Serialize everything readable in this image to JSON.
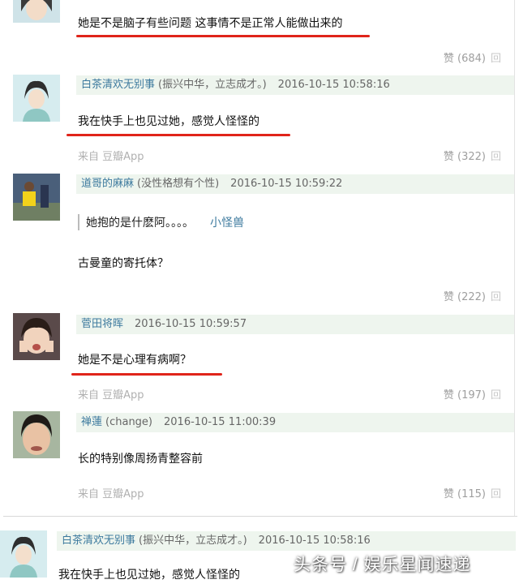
{
  "comments": [
    {
      "text": "她是不是脑子有些问题 这事情不是正常人能做出来的",
      "likes_label": "赞 (684)",
      "more_label": "回"
    },
    {
      "author": "白茶清欢无别事",
      "signature": "(振兴中华，立志成才。)",
      "time": "2016-10-15 10:58:16",
      "text": "我在快手上也见过她，感觉人怪怪的",
      "source": "来自 豆瓣App",
      "likes_label": "赞 (322)",
      "more_label": "回"
    },
    {
      "author": "道哥的麻麻",
      "signature": "(没性格想有个性)",
      "time": "2016-10-15 10:59:22",
      "quote_text": "她抱的是什麽阿。。。。",
      "quote_author": "小怪兽",
      "text": "古曼童的寄托体？",
      "likes_label": "赞 (222)",
      "more_label": "回"
    },
    {
      "author": "菅田将晖",
      "time": "2016-10-15 10:59:57",
      "text": "她是不是心理有病啊？",
      "source": "来自 豆瓣App",
      "likes_label": "赞 (197)",
      "more_label": "回"
    },
    {
      "author": "禅蓮",
      "signature": "(change)",
      "time": "2016-10-15 11:00:39",
      "text": "长的特别像周扬青整容前",
      "source": "来自 豆瓣App",
      "likes_label": "赞 (115)",
      "more_label": "回"
    },
    {
      "author": "白茶清欢无别事",
      "signature": "(振兴中华，立志成才。)",
      "time": "2016-10-15 10:58:16",
      "text": "我在快手上也见过她，感觉人怪怪的"
    }
  ],
  "watermark": "头条号 / 娱乐星闻速递",
  "colors": {
    "author_link": "#3d7a9e",
    "meta_bar_bg": "#eef5ee",
    "underline": "#e0241a",
    "muted": "#b0b0b0"
  }
}
